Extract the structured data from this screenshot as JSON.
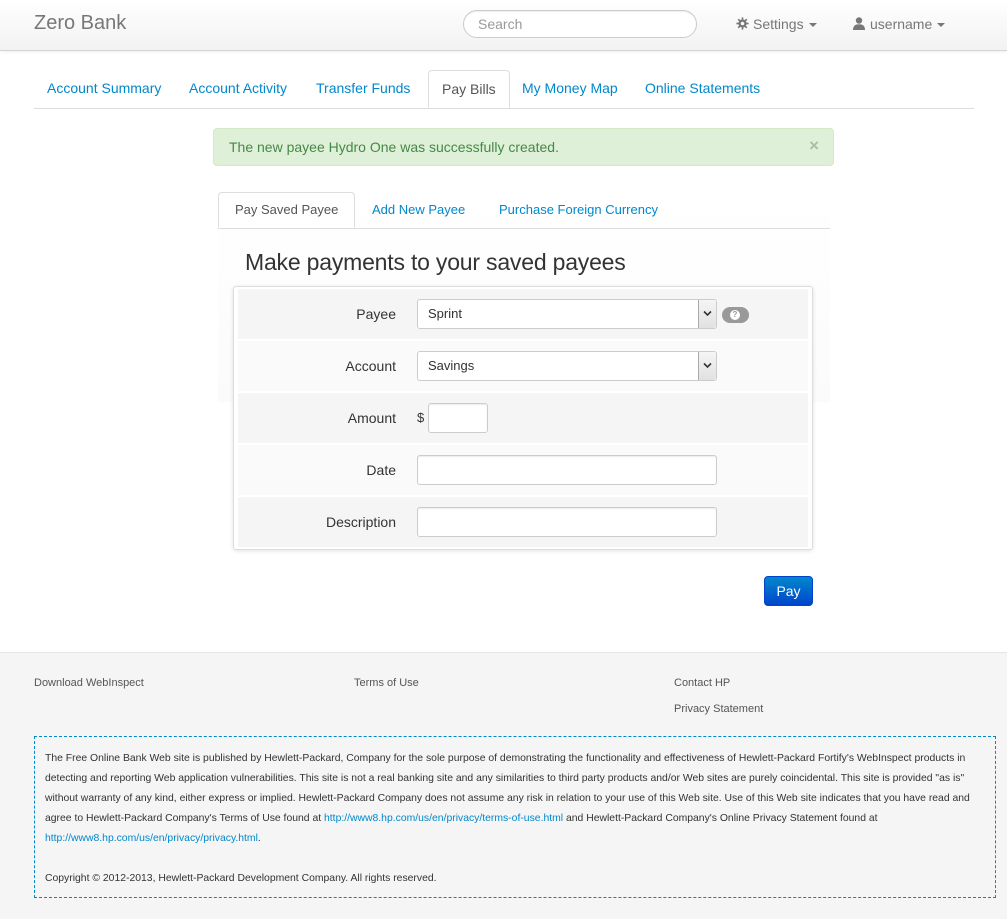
{
  "navbar": {
    "brand": "Zero Bank",
    "search_placeholder": "Search",
    "settings_label": "Settings",
    "user_label": "username"
  },
  "main_tabs": [
    {
      "label": "Account Summary",
      "active": false
    },
    {
      "label": "Account Activity",
      "active": false
    },
    {
      "label": "Transfer Funds",
      "active": false
    },
    {
      "label": "Pay Bills",
      "active": true
    },
    {
      "label": "My Money Map",
      "active": false
    },
    {
      "label": "Online Statements",
      "active": false
    }
  ],
  "alert": {
    "message": "The new payee Hydro One was successfully created.",
    "close": "×"
  },
  "sub_tabs": [
    {
      "label": "Pay Saved Payee",
      "active": true
    },
    {
      "label": "Add New Payee",
      "active": false
    },
    {
      "label": "Purchase Foreign Currency",
      "active": false
    }
  ],
  "form": {
    "heading": "Make payments to your saved payees",
    "payee_label": "Payee",
    "payee_value": "Sprint",
    "account_label": "Account",
    "account_value": "Savings",
    "amount_label": "Amount",
    "currency_symbol": "$",
    "amount_value": "",
    "date_label": "Date",
    "date_value": "",
    "description_label": "Description",
    "description_value": "",
    "pay_button": "Pay"
  },
  "footer": {
    "links": {
      "download": "Download WebInspect",
      "terms": "Terms of Use",
      "contact": "Contact HP",
      "privacy": "Privacy Statement"
    },
    "disclaimer_part1": "The Free Online Bank Web site is published by Hewlett-Packard, Company for the sole purpose of demonstrating the functionality and effectiveness of Hewlett-Packard Fortify's WebInspect products in detecting and reporting Web application vulnerabilities. This site is not a real banking site and any similarities to third party products and/or Web sites are purely coincidental. This site is provided \"as is\" without warranty of any kind, either express or implied. Hewlett-Packard Company does not assume any risk in relation to your use of this Web site. Use of this Web site indicates that you have read and agree to Hewlett-Packard Company's Terms of Use found at ",
    "terms_url": "http://www8.hp.com/us/en/privacy/terms-of-use.html",
    "disclaimer_part2": " and Hewlett-Packard Company's Online Privacy Statement found at ",
    "privacy_url": "http://www8.hp.com/us/en/privacy/privacy.html",
    "disclaimer_part3": ".",
    "copyright": "Copyright © 2012-2013, Hewlett-Packard Development Company. All rights reserved."
  }
}
